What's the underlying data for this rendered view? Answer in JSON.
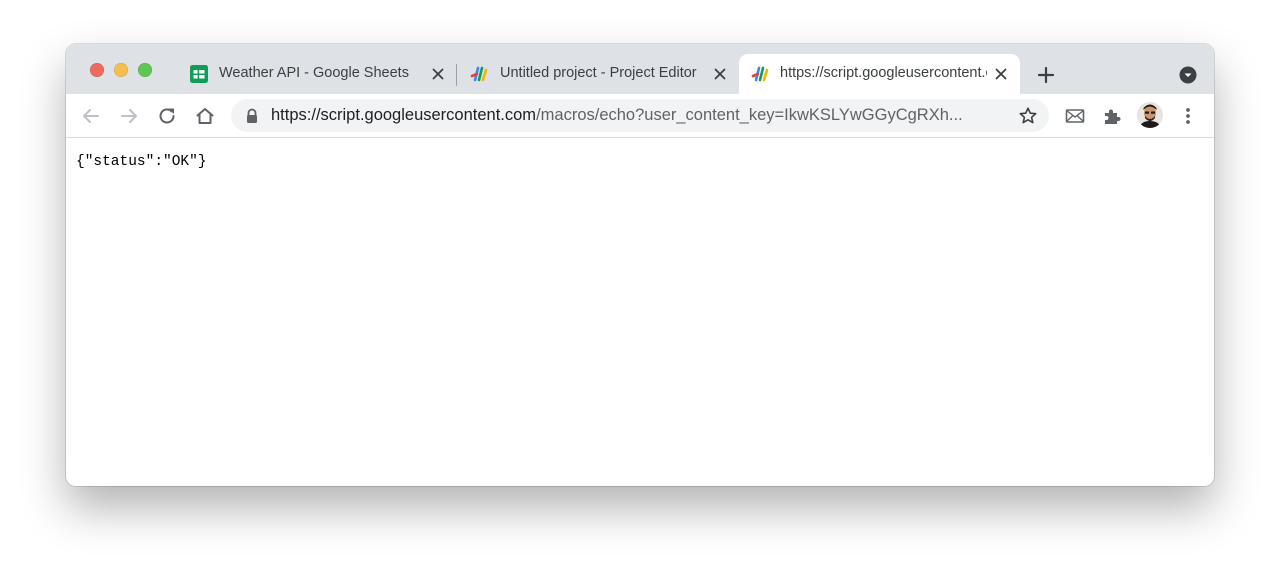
{
  "window": {
    "traffic_lights": [
      "close",
      "minimize",
      "zoom"
    ]
  },
  "tabs": [
    {
      "title": "Weather API - Google Sheets",
      "icon": "google-sheets-icon",
      "active": false
    },
    {
      "title": "Untitled project - Project Editor",
      "icon": "apps-script-icon",
      "active": false
    },
    {
      "title": "https://script.googleusercontent.com",
      "icon": "apps-script-icon",
      "active": true
    }
  ],
  "toolbar": {
    "url_host": "https://script.googleusercontent.com",
    "url_path": "/macros/echo?user_content_key=IkwKSLYwGGyCgRXh...",
    "icons": [
      "back-icon",
      "forward-icon",
      "reload-icon",
      "home-icon",
      "lock-icon",
      "bookmark-star-icon",
      "mail-extension-icon",
      "extensions-puzzle-icon",
      "profile-avatar",
      "menu-kebab-icon"
    ]
  },
  "page": {
    "body_text": "{\"status\":\"OK\"}"
  },
  "colors": {
    "tabstrip_bg": "#dee1e6",
    "omnibox_bg": "#f1f3f4",
    "traffic_red": "#ed6a5e",
    "traffic_yellow": "#f5bf4f",
    "traffic_green": "#61c554",
    "sheets_green": "#0f9d58"
  }
}
